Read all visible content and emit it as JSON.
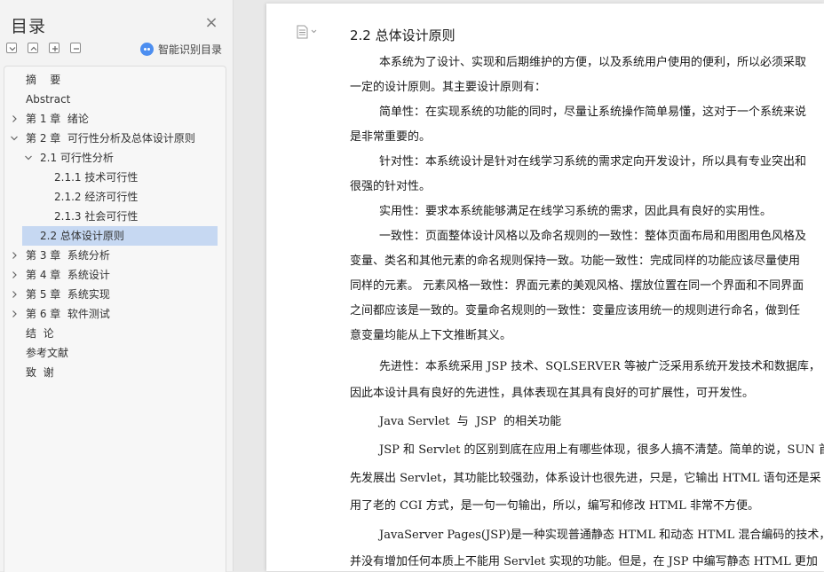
{
  "sidebar": {
    "title": "目录",
    "smart_toc_label": "智能识别目录",
    "items": [
      {
        "label": "摘    要",
        "level": 0,
        "chevron": ""
      },
      {
        "label": "Abstract",
        "level": 0,
        "chevron": ""
      },
      {
        "label": "第 1 章  绪论",
        "level": 0,
        "chevron": "right"
      },
      {
        "label": "第 2 章  可行性分析及总体设计原则",
        "level": 0,
        "chevron": "down"
      },
      {
        "label": "2.1 可行性分析",
        "level": 1,
        "chevron": "down"
      },
      {
        "label": "2.1.1 技术可行性",
        "level": 2,
        "chevron": ""
      },
      {
        "label": "2.1.2 经济可行性",
        "level": 2,
        "chevron": ""
      },
      {
        "label": "2.1.3 社会可行性",
        "level": 2,
        "chevron": ""
      },
      {
        "label": "2.2 总体设计原则",
        "level": 1,
        "chevron": "",
        "selected": true
      },
      {
        "label": "第 3 章  系统分析",
        "level": 0,
        "chevron": "right"
      },
      {
        "label": "第 4 章  系统设计",
        "level": 0,
        "chevron": "right"
      },
      {
        "label": "第 5 章  系统实现",
        "level": 0,
        "chevron": "right"
      },
      {
        "label": "第 6 章  软件测试",
        "level": 0,
        "chevron": "right"
      },
      {
        "label": "结  论",
        "level": 0,
        "chevron": ""
      },
      {
        "label": "参考文献",
        "level": 0,
        "chevron": ""
      },
      {
        "label": "致  谢",
        "level": 0,
        "chevron": ""
      }
    ]
  },
  "document": {
    "heading": "2.2 总体设计原则",
    "lines": [
      "        本系统为了设计、实现和后期维护的方便，以及系统用户使用的便利，所以必须采取",
      "一定的设计原则。其主要设计原则有：",
      "        简单性：在实现系统的功能的同时，尽量让系统操作简单易懂，这对于一个系统来说",
      "是非常重要的。",
      "        针对性：本系统设计是针对在线学习系统的需求定向开发设计，所以具有专业突出和",
      "很强的针对性。",
      "        实用性：要求本系统能够满足在线学习系统的需求，因此具有良好的实用性。",
      "        一致性：页面整体设计风格以及命名规则的一致性：整体页面布局和用图用色风格及",
      "变量、类名和其他元素的命名规则保持一致。功能一致性：完成同样的功能应该尽量使用",
      "同样的元素。 元素风格一致性：界面元素的美观风格、摆放位置在同一个界面和不同界面",
      "之间都应该是一致的。变量命名规则的一致性：变量应该用统一的规则进行命名，做到任",
      "意变量均能从上下文推断其义。",
      "        先进性：本系统采用 JSP 技术、SQLSERVER 等被广泛采用系统开发技术和数据库，",
      "因此本设计具有良好的先进性，具体表现在其具有良好的可扩展性，可开发性。",
      "        Java Servlet  与  JSP  的相关功能",
      "        JSP 和 Servlet 的区别到底在应用上有哪些体现，很多人搞不清楚。简单的说，SUN 首",
      "先发展出 Servlet，其功能比较强劲，体系设计也很先进，只是，它输出 HTML 语句还是采",
      "用了老的 CGI 方式，是一句一句输出，所以，编写和修改 HTML 非常不方便。",
      "        JavaServer Pages(JSP)是一种实现普通静态 HTML 和动态 HTML 混合编码的技术，JSP",
      "并没有增加任何本质上不能用 Servlet 实现的功能。但是，在 JSP 中编写静态 HTML 更加"
    ]
  }
}
